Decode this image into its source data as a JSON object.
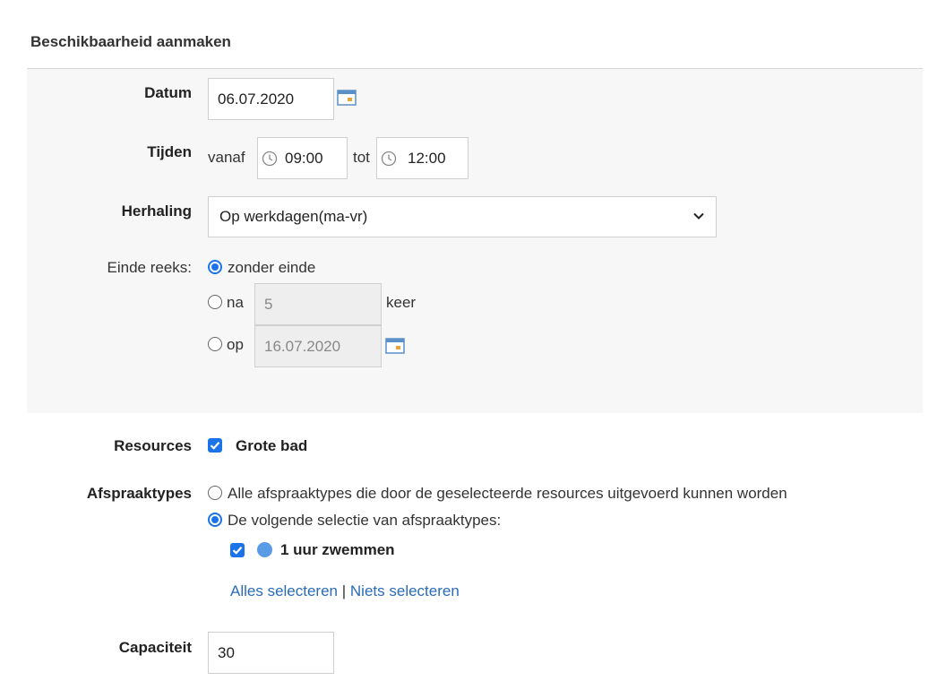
{
  "header": {
    "title": "Beschikbaarheid aanmaken"
  },
  "form": {
    "datum": {
      "label": "Datum",
      "value": "06.07.2020"
    },
    "tijden": {
      "label": "Tijden",
      "from_label": "vanaf",
      "from_value": "09:00",
      "to_label": "tot",
      "to_value": "12:00"
    },
    "herhaling": {
      "label": "Herhaling",
      "value": "Op werkdagen(ma-vr)"
    },
    "einde_reeks": {
      "label": "Einde reeks:",
      "option_none": "zonder einde",
      "option_after": "na",
      "after_value": "5",
      "after_suffix": "keer",
      "option_on": "op",
      "on_value": "16.07.2020",
      "selected": "zonder einde"
    },
    "resources": {
      "label": "Resources",
      "item": "Grote bad",
      "checked": true
    },
    "afspraaktypes": {
      "label": "Afspraaktypes",
      "option_all": "Alle afspraaktypes die door de geselecteerde resources uitgevoerd kunnen worden",
      "option_selection": "De volgende selectie van afspraaktypes:",
      "selected": "De volgende selectie van afspraaktypes:",
      "item": "1 uur zwemmen",
      "item_checked": true,
      "item_color": "#5b9be6",
      "select_all": "Alles selecteren",
      "separator": "|",
      "select_none": "Niets selecteren"
    },
    "capaciteit": {
      "label": "Capaciteit",
      "value": "30"
    }
  },
  "colors": {
    "accent": "#1a73e8",
    "link": "#2a6bb8"
  }
}
